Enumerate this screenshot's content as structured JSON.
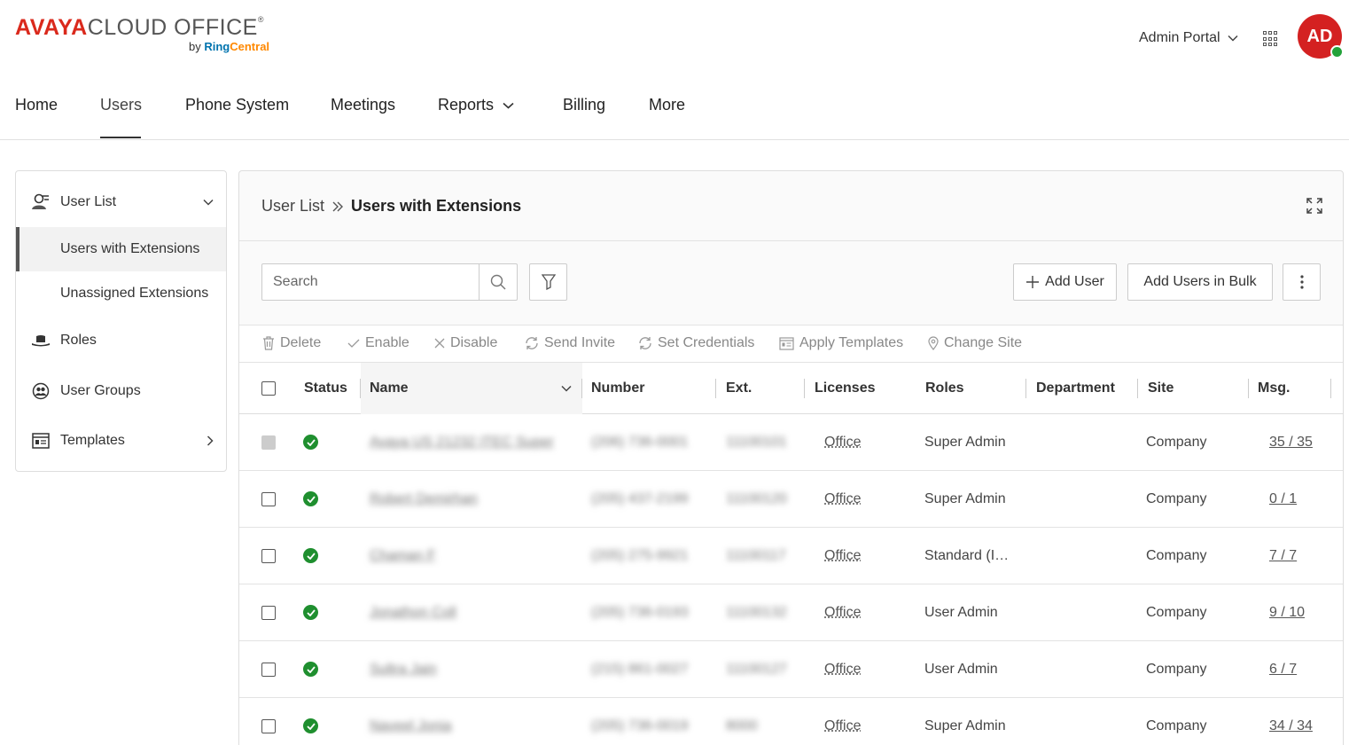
{
  "brand": {
    "avaya": "AVAYA",
    "cloud": "CLOUD OFFICE",
    "reg": "®",
    "by": "by",
    "ring": "Ring",
    "central": "Central"
  },
  "header": {
    "portal_label": "Admin Portal",
    "avatar_initials": "AD",
    "avatar_color": "#d42121",
    "presence_color": "#23a23a"
  },
  "topnav": {
    "items": [
      {
        "label": "Home"
      },
      {
        "label": "Users"
      },
      {
        "label": "Phone System"
      },
      {
        "label": "Meetings"
      },
      {
        "label": "Reports"
      },
      {
        "label": "Billing"
      },
      {
        "label": "More"
      }
    ],
    "active": "Users"
  },
  "sidebar": {
    "user_list": "User List",
    "users_with_extensions": "Users with Extensions",
    "unassigned_extensions": "Unassigned Extensions",
    "roles": "Roles",
    "user_groups": "User Groups",
    "templates": "Templates"
  },
  "main": {
    "breadcrumb_parent": "User List",
    "breadcrumb_current": "Users with Extensions",
    "search_placeholder": "Search",
    "add_user": "Add User",
    "add_users_bulk": "Add Users in Bulk",
    "actions": {
      "delete": "Delete",
      "enable": "Enable",
      "disable": "Disable",
      "send_invite": "Send Invite",
      "set_credentials": "Set Credentials",
      "apply_templates": "Apply Templates",
      "change_site": "Change Site"
    },
    "columns": {
      "status": "Status",
      "name": "Name",
      "number": "Number",
      "ext": "Ext.",
      "licenses": "Licenses",
      "roles": "Roles",
      "department": "Department",
      "site": "Site",
      "msg": "Msg."
    },
    "rows": [
      {
        "name": "Avaya US 21232 ITEC Super",
        "number": "(206) 736-0001",
        "ext": "11100101",
        "license": "Office",
        "role": "Super Admin",
        "department": "",
        "site": "Company",
        "msg": "35 / 35"
      },
      {
        "name": "Robert Demirhan",
        "number": "(205) 437-2199",
        "ext": "11100120",
        "license": "Office",
        "role": "Super Admin",
        "department": "",
        "site": "Company",
        "msg": "0 / 1"
      },
      {
        "name": "Chaman F",
        "number": "(205) 275-9921",
        "ext": "11100117",
        "license": "Office",
        "role": "Standard (I…",
        "department": "",
        "site": "Company",
        "msg": "7 / 7"
      },
      {
        "name": "Jonathon Coll",
        "number": "(205) 736-0193",
        "ext": "11100132",
        "license": "Office",
        "role": "User Admin",
        "department": "",
        "site": "Company",
        "msg": "9 / 10"
      },
      {
        "name": "Sultra Jain",
        "number": "(215) 861-0027",
        "ext": "11100127",
        "license": "Office",
        "role": "User Admin",
        "department": "",
        "site": "Company",
        "msg": "6 / 7"
      },
      {
        "name": "Naveel Jonia",
        "number": "(205) 736-0019",
        "ext": "8000",
        "license": "Office",
        "role": "Super Admin",
        "department": "",
        "site": "Company",
        "msg": "34 / 34"
      }
    ]
  }
}
